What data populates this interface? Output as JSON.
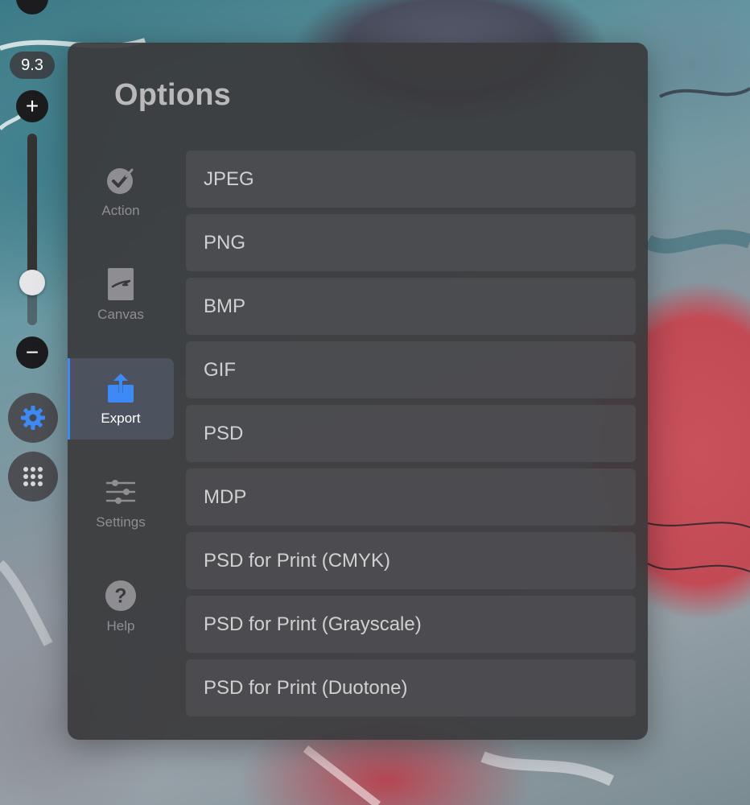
{
  "canvas": {
    "brush_size": "9.3"
  },
  "toolstrip": {
    "plus_icon": "+",
    "minus_icon": "−",
    "top_minus_icon": "−",
    "slider_value_fraction": 0.76,
    "settings_icon": "gear-icon",
    "menu_icon": "grid-dots-icon",
    "accent_color": "#3d8af7"
  },
  "panel": {
    "title": "Options",
    "nav": [
      {
        "label": "Action",
        "icon": "check-badge-icon",
        "active": false
      },
      {
        "label": "Canvas",
        "icon": "canvas-icon",
        "active": false
      },
      {
        "label": "Export",
        "icon": "export-icon",
        "active": true
      },
      {
        "label": "Settings",
        "icon": "sliders-icon",
        "active": false
      },
      {
        "label": "Help",
        "icon": "question-icon",
        "active": false
      }
    ],
    "export_formats": [
      "JPEG",
      "PNG",
      "BMP",
      "GIF",
      "PSD",
      "MDP",
      "PSD for Print (CMYK)",
      "PSD for Print (Grayscale)",
      "PSD for Print (Duotone)"
    ]
  }
}
